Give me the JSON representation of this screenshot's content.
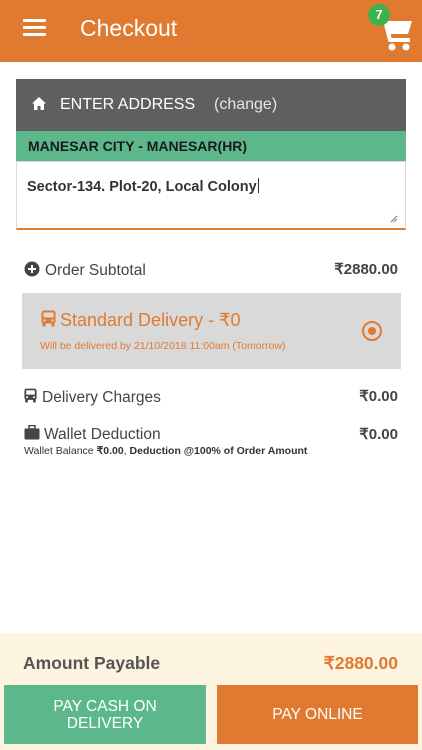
{
  "header": {
    "title": "Checkout",
    "cart_count": "7",
    "menu_icon": "hamburger-icon",
    "cart_icon": "cart-icon",
    "bg_color": "#e07a30"
  },
  "address": {
    "heading": "ENTER ADDRESS",
    "change_label": "(change)",
    "city": "MANESAR CITY - MANESAR(HR)",
    "value": "Sector-134. Plot-20, Local Colony"
  },
  "summary": {
    "subtotal_label": "Order Subtotal",
    "subtotal_value": "₹2880.00",
    "delivery_option": {
      "title": "Standard Delivery - ₹0",
      "subtitle": "Will be delivered by 21/10/2018 11:00am (Tomorrow)",
      "selected": true
    },
    "delivery_charges_label": "Delivery Charges",
    "delivery_charges_value": "₹0.00",
    "wallet_label": "Wallet Deduction",
    "wallet_value": "₹0.00",
    "wallet_balance_prefix": "Wallet Balance ",
    "wallet_balance_value": "₹0.00",
    "wallet_deduction_note": "Deduction @100% of Order Amount"
  },
  "footer": {
    "amount_label": "Amount Payable",
    "amount_value": "₹2880.00",
    "cod_button": "PAY CASH ON DELIVERY",
    "online_button": "PAY ONLINE"
  },
  "colors": {
    "accent": "#e07a30",
    "green": "#5cb88a",
    "dark_header": "#5f5f5f",
    "footer_bg": "#fdf5e0"
  }
}
